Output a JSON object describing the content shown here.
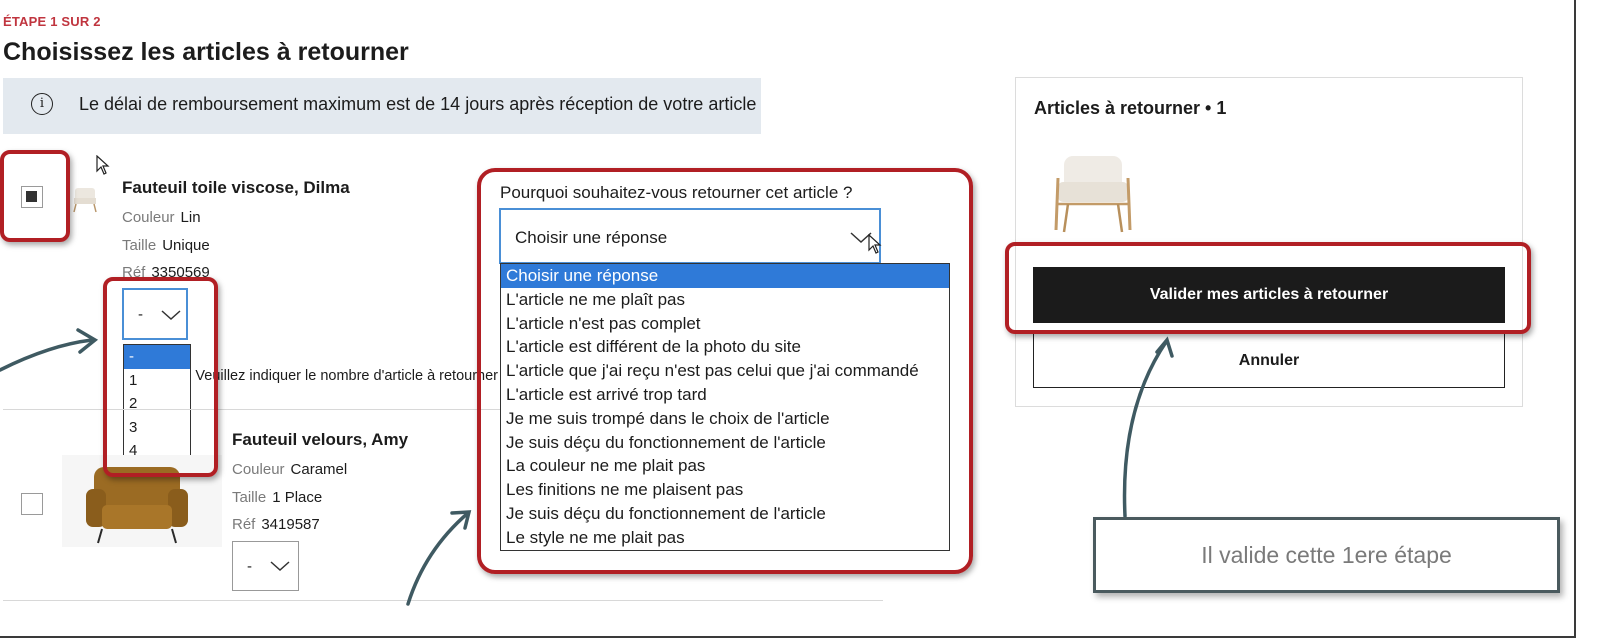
{
  "header": {
    "step": "ÉTAPE 1 SUR 2",
    "title": "Choisissez les articles à retourner",
    "info_text": "Le délai de remboursement maximum est de 14 jours après réception de votre article"
  },
  "products": [
    {
      "name": "Fauteuil toile viscose, Dilma",
      "color_label": "Couleur",
      "color": "Lin",
      "size_label": "Taille",
      "size": "Unique",
      "ref_label": "Réf",
      "ref": "3350569",
      "checked": true,
      "qty_value": "-",
      "qty_hint": "Veuillez indiquer le nombre d'article à retourner"
    },
    {
      "name": "Fauteuil velours, Amy",
      "color_label": "Couleur",
      "color": "Caramel",
      "size_label": "Taille",
      "size": "1 Place",
      "ref_label": "Réf",
      "ref": "3419587",
      "checked": false,
      "qty_value": "-"
    }
  ],
  "qty_options": [
    "-",
    "1",
    "2",
    "3",
    "4"
  ],
  "reason": {
    "label": "Pourquoi souhaitez-vous retourner cet article ?",
    "selected": "Choisir une réponse",
    "options": [
      "Choisir une réponse",
      "L'article ne me plaît pas",
      "L'article n'est pas complet",
      "L'article est différent de la photo du site",
      "L'article que j'ai reçu n'est pas celui que j'ai commandé",
      "L'article est arrivé trop tard",
      "Je me suis trompé dans le choix de l'article",
      "Je suis déçu du fonctionnement de l'article",
      "La couleur ne me plait pas",
      "Les finitions ne me plaisent pas",
      "Je suis déçu du fonctionnement de l'article",
      "Le style ne me plait pas"
    ]
  },
  "cart": {
    "title": "Articles à retourner • 1",
    "validate_label": "Valider mes articles à retourner",
    "cancel_label": "Annuler"
  },
  "annotation": {
    "callout_text": "Il valide cette 1ere étape"
  },
  "colors": {
    "highlight": "#b11f24",
    "step_accent": "#c0353f",
    "select_blue": "#2f7ad8",
    "button_dark": "#1b1b1b",
    "arrow": "#3f5a62"
  }
}
